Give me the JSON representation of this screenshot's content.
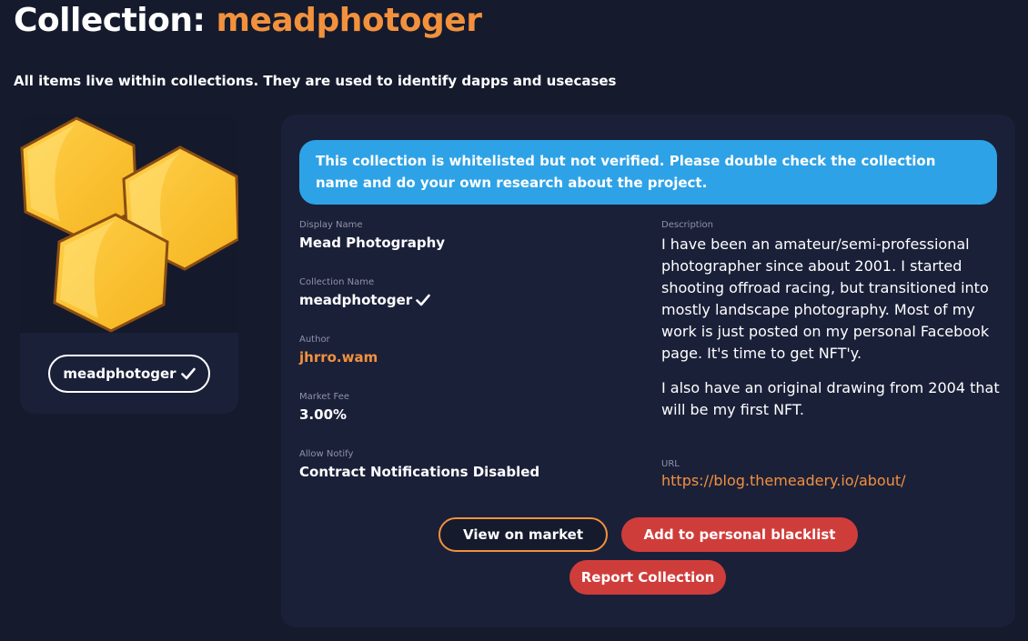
{
  "header": {
    "title_prefix": "Collection:",
    "title_name": "meadphotoger",
    "subtitle": "All items live within collections. They are used to identify dapps and usecases"
  },
  "left_card": {
    "image_icon": "honeycomb-logo",
    "collection_pill": "meadphotoger",
    "verified_icon": "checkmark-icon"
  },
  "notice": {
    "text": "This collection is whitelisted but not verified. Please double check the collection name and do your own research about the project."
  },
  "fields": {
    "display_name": {
      "label": "Display Name",
      "value": "Mead Photography"
    },
    "collection_name": {
      "label": "Collection Name",
      "value": "meadphotoger"
    },
    "author": {
      "label": "Author",
      "value": "jhrro.wam"
    },
    "market_fee": {
      "label": "Market Fee",
      "value": "3.00%"
    },
    "allow_notify": {
      "label": "Allow Notify",
      "value": "Contract Notifications Disabled"
    }
  },
  "description": {
    "label": "Description",
    "paragraphs": [
      "I have been an amateur/semi-professional photographer since about 2001. I started shooting offroad racing, but transitioned into mostly landscape photography. Most of my work is just posted on my personal Facebook page. It's time to get NFT'y.",
      "I also have an original drawing from 2004 that will be my first NFT."
    ]
  },
  "url": {
    "label": "URL",
    "value": "https://blog.themeadery.io/about/"
  },
  "buttons": {
    "view_market": "View on market",
    "blacklist": "Add to personal blacklist",
    "report": "Report Collection"
  },
  "colors": {
    "background": "#151a2d",
    "card": "#1b2039",
    "accent": "#f2913d",
    "notice": "#2ea2e6",
    "danger": "#cf3d3b",
    "honey": "#fcc02b"
  }
}
